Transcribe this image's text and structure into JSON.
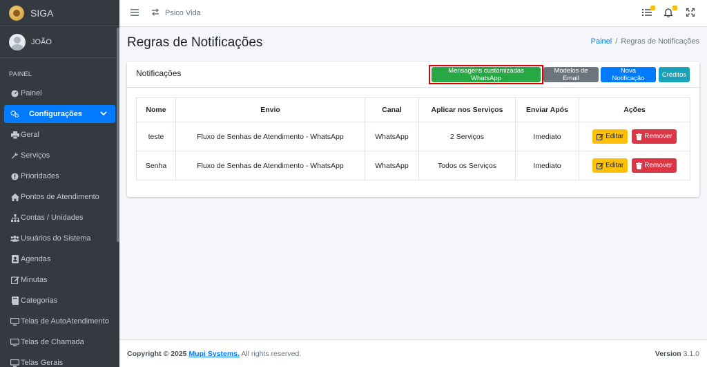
{
  "brand": {
    "name": "SIGA"
  },
  "user": {
    "name": "JOÃO"
  },
  "sidebar": {
    "header": "PAINEL",
    "items": [
      {
        "label": "Painel",
        "icon": "dashboard-icon"
      },
      {
        "label": "Configurações",
        "icon": "cogs-icon",
        "active": true
      },
      {
        "label": "Geral",
        "icon": "printer-icon"
      },
      {
        "label": "Serviços",
        "icon": "wrench-icon"
      },
      {
        "label": "Prioridades",
        "icon": "exclamation-circle-icon"
      },
      {
        "label": "Pontos de Atendimento",
        "icon": "home-icon"
      },
      {
        "label": "Contas / Unidades",
        "icon": "sitemap-icon"
      },
      {
        "label": "Usuários do Sistema",
        "icon": "users-icon"
      },
      {
        "label": "Agendas",
        "icon": "address-book-icon"
      },
      {
        "label": "Minutas",
        "icon": "edit-icon"
      },
      {
        "label": "Categorias",
        "icon": "book-icon"
      },
      {
        "label": "Telas de AutoAtendimento",
        "icon": "monitor-icon"
      },
      {
        "label": "Telas de Chamada",
        "icon": "monitor-icon"
      },
      {
        "label": "Telas Gerais",
        "icon": "monitor-icon"
      }
    ]
  },
  "topbar": {
    "context": "Psico Vida"
  },
  "page": {
    "title": "Regras de Notificações"
  },
  "breadcrumb": {
    "home": "Painel",
    "current": "Regras de Notificações"
  },
  "card": {
    "title": "Notificações",
    "buttons": {
      "whatsapp": "Mensagens customizadas WhatsApp",
      "email": "Modelos de Email",
      "new": "Nova Notificação",
      "credits": "Créditos"
    }
  },
  "table": {
    "headers": [
      "Nome",
      "Envio",
      "Canal",
      "Aplicar nos Serviços",
      "Enviar Após",
      "Ações"
    ],
    "rows": [
      {
        "nome": "teste",
        "envio": "Fluxo de Senhas de Atendimento - WhatsApp",
        "canal": "WhatsApp",
        "servicos": "2 Serviços",
        "apos": "Imediato"
      },
      {
        "nome": "Senha",
        "envio": "Fluxo de Senhas de Atendimento - WhatsApp",
        "canal": "WhatsApp",
        "servicos": "Todos os Serviços",
        "apos": "Imediato"
      }
    ],
    "edit_label": "Editar",
    "remove_label": "Remover"
  },
  "footer": {
    "copyright": "Copyright © 2025",
    "company": "Mupi Systems.",
    "rights": "All rights reserved.",
    "version_label": "Version",
    "version": "3.1.0"
  },
  "colors": {
    "primary": "#007bff",
    "success": "#28a745",
    "warning": "#ffc107",
    "danger": "#dc3545",
    "info": "#17a2b8",
    "sidebar": "#343a40",
    "highlight": "#e00000"
  }
}
